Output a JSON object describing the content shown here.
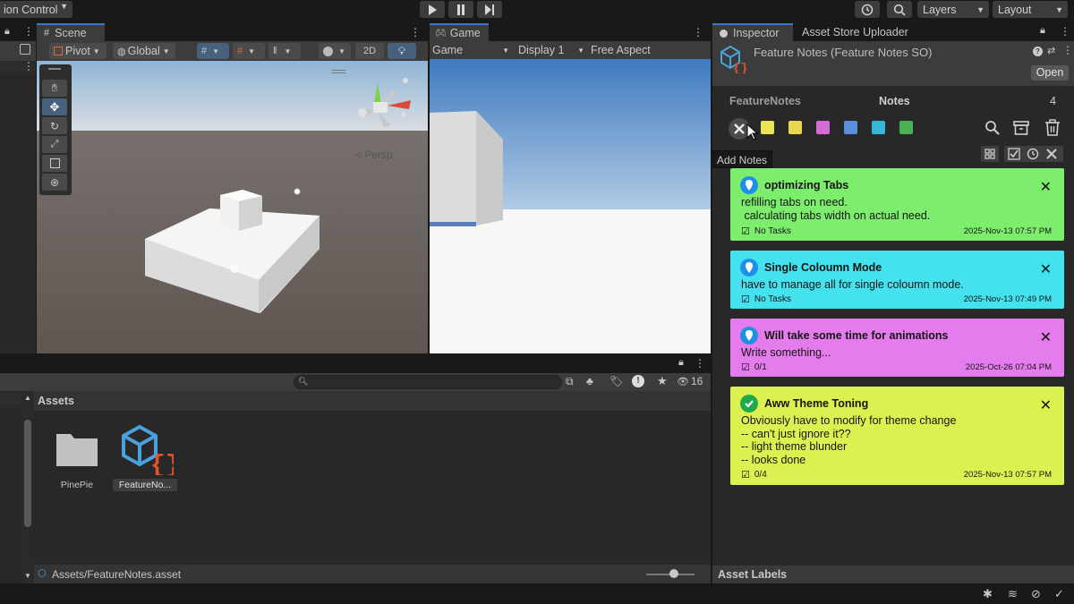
{
  "topbar": {
    "version_control": "ion Control",
    "layers": "Layers",
    "layout": "Layout"
  },
  "scene": {
    "tab": "Scene",
    "pivot": "Pivot",
    "global": "Global",
    "mode_2d": "2D",
    "persp": "< Persp"
  },
  "game": {
    "tab": "Game",
    "game_dropdown": "Game",
    "display": "Display 1",
    "aspect": "Free Aspect"
  },
  "project": {
    "hidden_count": "16",
    "assets_header": "Assets",
    "items": [
      {
        "label": "PinePie",
        "type": "folder"
      },
      {
        "label": "FeatureNo...",
        "type": "asset"
      }
    ],
    "path": "Assets/FeatureNotes.asset"
  },
  "inspector": {
    "tab": "Inspector",
    "tab2": "Asset Store Uploader",
    "object_title": "Feature Notes (Feature Notes SO)",
    "open_button": "Open",
    "feature_label": "FeatureNotes",
    "notes_label": "Notes",
    "notes_count": "4",
    "tooltip": "Add Notes",
    "asset_labels": "Asset Labels",
    "colors": {
      "swatches": [
        "#e8e455",
        "#e8d64e",
        "#d56bd6",
        "#5a8fde",
        "#35b8d8",
        "#4ab055"
      ]
    },
    "notes": [
      {
        "title": "optimizing Tabs",
        "body": "refilling tabs on need.\n calculating tabs width on actual need.",
        "tasks": "No Tasks",
        "date": "2025-Nov-13 07:57 PM",
        "color": "#7ded6e",
        "icon": "pin-icon"
      },
      {
        "title": "Single Coloumn Mode",
        "body": "have to manage all for single coloumn mode.",
        "tasks": "No Tasks",
        "date": "2025-Nov-13 07:49 PM",
        "color": "#44e1ee",
        "icon": "pin-icon"
      },
      {
        "title": "Will take some time for animations",
        "body": "Write something...",
        "tasks": "0/1",
        "date": "2025-Oct-26 07:04 PM",
        "color": "#e57ced",
        "icon": "pin-icon"
      },
      {
        "title": "Aww Theme Toning",
        "body": "Obviously have to modify for theme change\n-- can't just ignore it??\n-- light theme blunder\n-- looks done",
        "tasks": "0/4",
        "date": "2025-Nov-13 07:57 PM",
        "color": "#dcf14f",
        "icon": "check-circle-icon"
      }
    ]
  }
}
